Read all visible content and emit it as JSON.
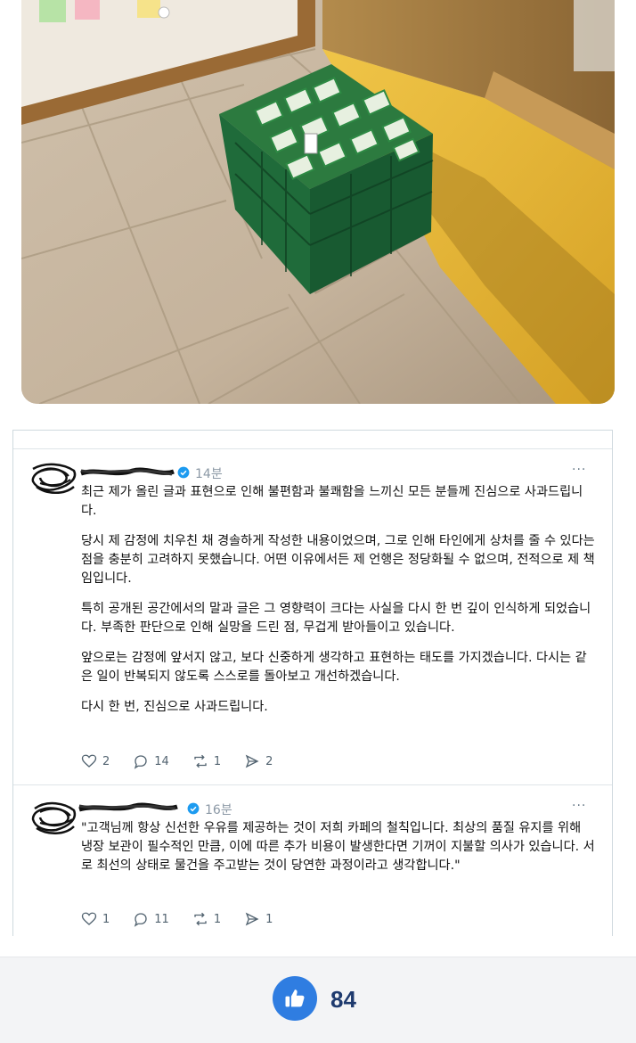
{
  "tweets": [
    {
      "time": "14분",
      "more_label": "···",
      "paragraphs": [
        "최근 제가 올린 글과 표현으로 인해 불편함과 불쾌함을 느끼신 모든 분들께 진심으로 사과드립니다.",
        "당시 제 감정에 치우친 채 경솔하게 작성한 내용이었으며, 그로 인해 타인에게 상처를 줄 수 있다는 점을 충분히 고려하지 못했습니다. 어떤 이유에서든 제 언행은 정당화될 수 없으며, 전적으로 제 책임입니다.",
        "특히 공개된 공간에서의 말과 글은 그 영향력이 크다는 사실을 다시 한 번 깊이 인식하게 되었습니다. 부족한 판단으로 인해 실망을 드린 점, 무겁게 받아들이고 있습니다.",
        "앞으로는 감정에 앞서지 않고, 보다 신중하게 생각하고 표현하는 태도를 가지겠습니다. 다시는 같은 일이 반복되지 않도록 스스로를 돌아보고 개선하겠습니다.",
        "다시 한 번, 진심으로 사과드립니다."
      ],
      "likes": "2",
      "replies": "14",
      "reposts": "1",
      "shares": "2"
    },
    {
      "time": "16분",
      "more_label": "···",
      "paragraphs": [
        "\"고객님께 항상 신선한 우유를 제공하는 것이 저희 카페의 철칙입니다. 최상의 품질 유지를 위해 냉장 보관이 필수적인 만큼, 이에 따른 추가 비용이 발생한다면 기꺼이 지불할 의사가 있습니다. 서로 최선의 상태로 물건을 주고받는 것이 당연한 과정이라고 생각합니다.\""
      ],
      "likes": "1",
      "replies": "11",
      "reposts": "1",
      "shares": "1"
    }
  ],
  "footer": {
    "like_count": "84"
  },
  "colors": {
    "verified": "#1d9bf0",
    "like_button": "#2f7de1",
    "crate": "#1f6b3a"
  },
  "icons": [
    "heart-icon",
    "comment-icon",
    "repost-icon",
    "share-icon",
    "thumbs-up-icon",
    "verified-badge-icon"
  ]
}
